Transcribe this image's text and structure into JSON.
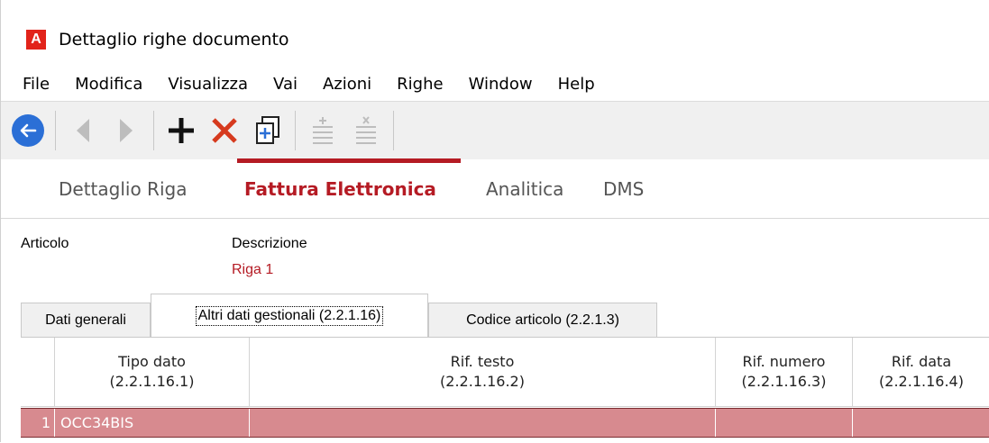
{
  "window": {
    "title": "Dettaglio righe documento",
    "app_icon_letter": "A"
  },
  "menu": [
    "File",
    "Modifica",
    "Visualizza",
    "Vai",
    "Azioni",
    "Righe",
    "Window",
    "Help"
  ],
  "toolbar": {
    "buttons": [
      "back-icon",
      "previous-icon",
      "next-icon",
      "add-icon",
      "delete-icon",
      "duplicate-icon",
      "insert-row-icon",
      "delete-row-icon"
    ]
  },
  "main_tabs": [
    "Dettaglio Riga",
    "Fattura Elettronica",
    "Analitica",
    "DMS"
  ],
  "fields": {
    "articolo_label": "Articolo",
    "descrizione_label": "Descrizione",
    "descrizione_value": "Riga 1"
  },
  "sub_tabs": [
    "Dati generali",
    "Altri dati gestionali (2.2.1.16)",
    "Codice articolo (2.2.1.3)"
  ],
  "grid": {
    "columns": [
      {
        "line1": "Tipo dato",
        "line2": "(2.2.1.16.1)"
      },
      {
        "line1": "Rif. testo",
        "line2": "(2.2.1.16.2)"
      },
      {
        "line1": "Rif. numero",
        "line2": "(2.2.1.16.3)"
      },
      {
        "line1": "Rif. data",
        "line2": "(2.2.1.16.4)"
      }
    ],
    "rows": [
      {
        "index": "1",
        "tipo_dato": "OCC34BIS",
        "rif_testo": "",
        "rif_numero": "",
        "rif_data": ""
      }
    ]
  },
  "colors": {
    "accent": "#b51b24",
    "selected_row": "#d78a8f",
    "back_button": "#2b6fd6",
    "delete_icon": "#d63a1e"
  }
}
